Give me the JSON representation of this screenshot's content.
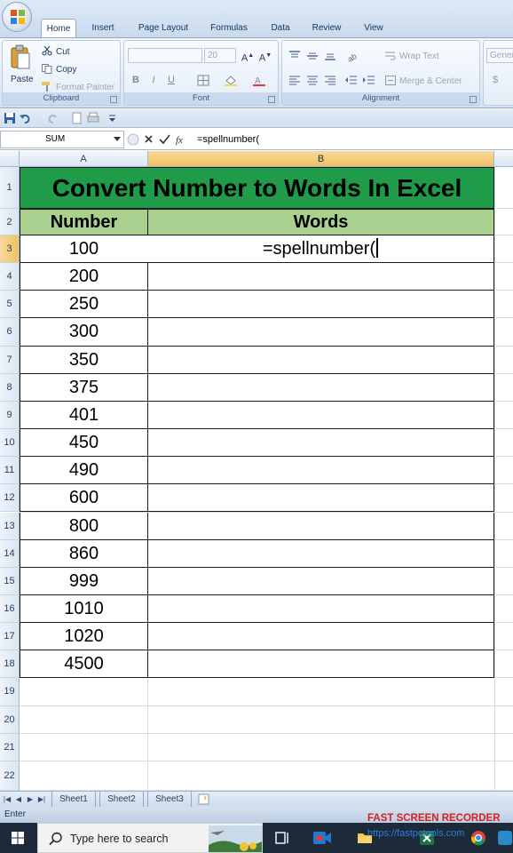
{
  "ribbon": {
    "tabs": [
      {
        "label": "Home",
        "active": true
      },
      {
        "label": "Insert",
        "active": false
      },
      {
        "label": "Page Layout",
        "active": false
      },
      {
        "label": "Formulas",
        "active": false
      },
      {
        "label": "Data",
        "active": false
      },
      {
        "label": "Review",
        "active": false
      },
      {
        "label": "View",
        "active": false
      }
    ],
    "clipboard": {
      "paste": "Paste",
      "cut": "Cut",
      "copy": "Copy",
      "format_painter": "Format Painter",
      "label": "Clipboard"
    },
    "font": {
      "size": "20",
      "label": "Font",
      "bold": "B",
      "italic": "I",
      "underline": "U"
    },
    "alignment": {
      "wrap_text": "Wrap Text",
      "merge_center": "Merge & Center",
      "label": "Alignment"
    },
    "number": {
      "format": "Gener",
      "currency": "$"
    }
  },
  "formula_bar": {
    "name_box": "SUM",
    "fx": "fx",
    "formula": "=spellnumber("
  },
  "columns": [
    "A",
    "B"
  ],
  "sheet": {
    "title": "Convert Number to Words In Excel",
    "header_number": "Number",
    "header_words": "Words",
    "editing_text": "=spellnumber(",
    "numbers": [
      "100",
      "200",
      "250",
      "300",
      "350",
      "375",
      "401",
      "450",
      "490",
      "600",
      "800",
      "860",
      "999",
      "1010",
      "1020",
      "4500"
    ]
  },
  "rows": [
    "1",
    "2",
    "3",
    "4",
    "5",
    "6",
    "7",
    "8",
    "9",
    "10",
    "11",
    "12",
    "13",
    "14",
    "15",
    "16",
    "17",
    "18",
    "19",
    "20",
    "21",
    "22"
  ],
  "sheet_tabs": [
    {
      "label": "Sheet1",
      "active": true
    },
    {
      "label": "Sheet2",
      "active": false
    },
    {
      "label": "Sheet3",
      "active": false
    }
  ],
  "status": {
    "mode": "Enter"
  },
  "taskbar": {
    "search_placeholder": "Type here to search"
  },
  "overlay": {
    "recorder": "FAST SCREEN RECORDER",
    "url": "https://fastpctools.com"
  },
  "colors": {
    "title_green": "#1f9b4a",
    "header_green": "#a9d08e",
    "selected_header": "#f1c15f"
  }
}
